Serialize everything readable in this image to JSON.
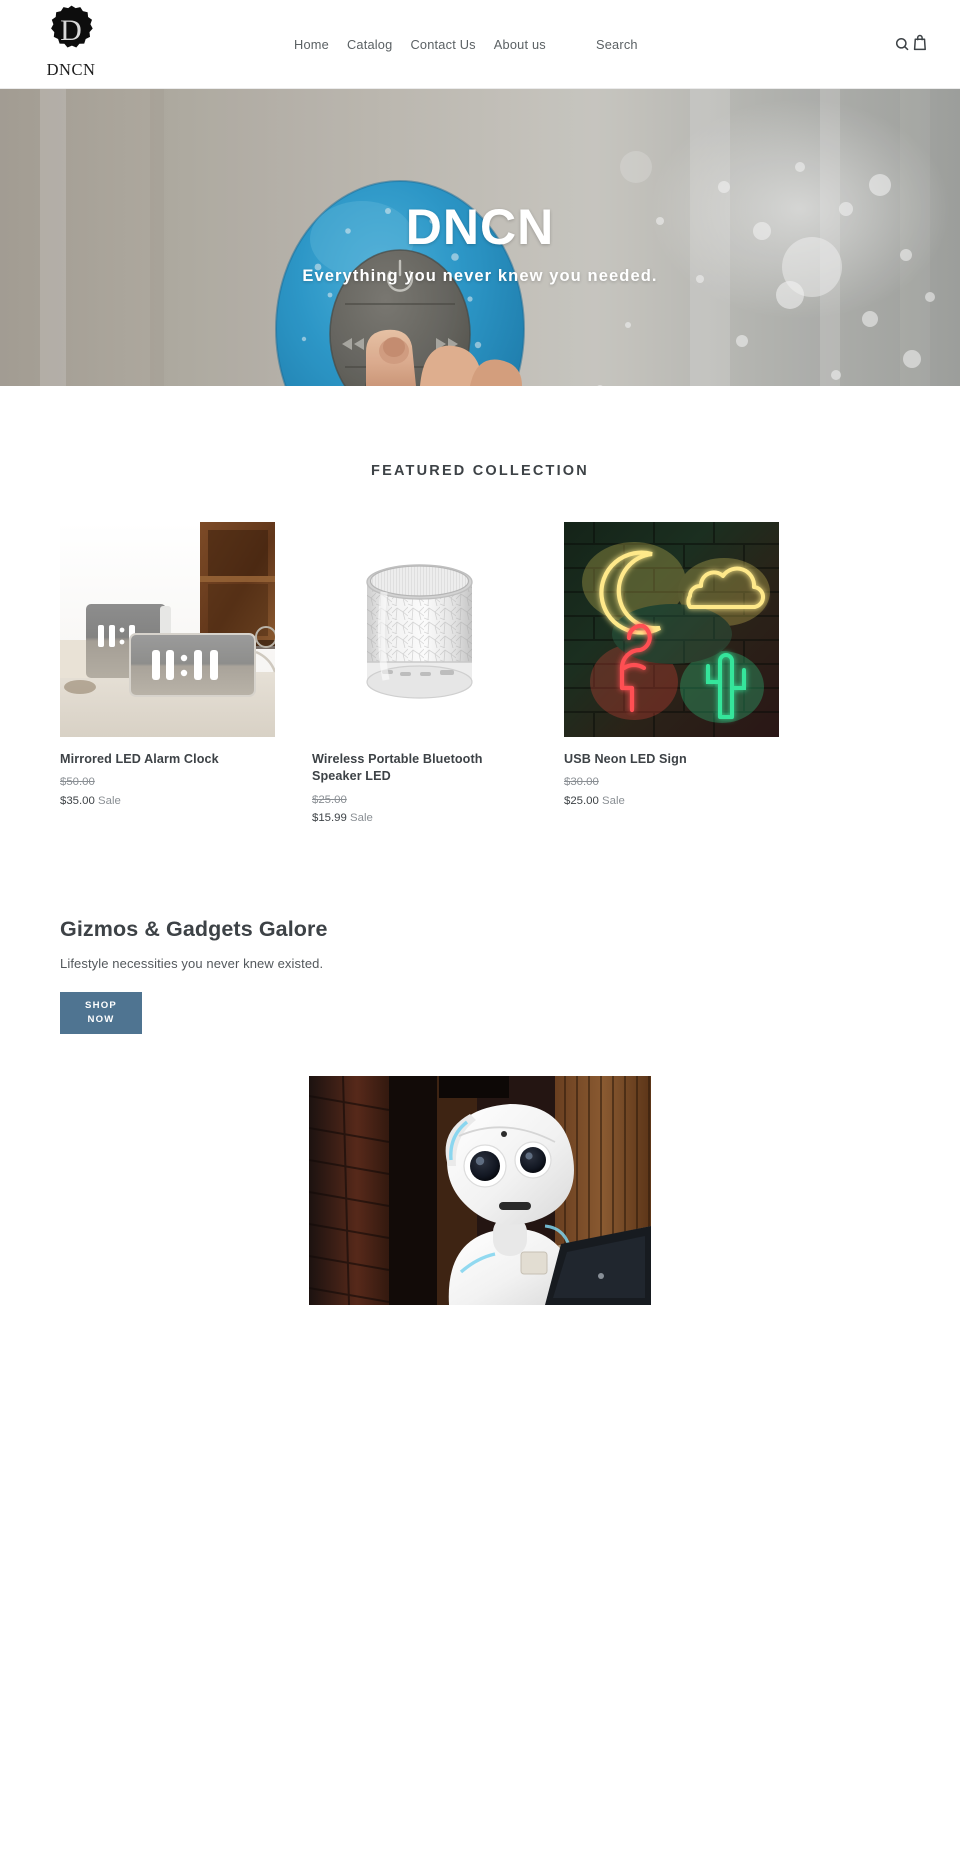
{
  "header": {
    "logo": {
      "letter": "D",
      "wordmark": "DNCN",
      "alt": "DNCN logo"
    },
    "nav": [
      {
        "label": "Home"
      },
      {
        "label": "Catalog"
      },
      {
        "label": "Contact Us"
      },
      {
        "label": "About us"
      }
    ],
    "search_label": "Search",
    "icons": {
      "search": "search-icon",
      "cart": "shopping-bag-icon"
    }
  },
  "hero": {
    "title": "DNCN",
    "subtitle": "Everything you never knew you needed.",
    "image_alt": "Blue waterproof shower bluetooth speaker being pressed by a finger on wet glass"
  },
  "featured": {
    "heading": "FEATURED COLLECTION",
    "products": [
      {
        "title": "Mirrored LED Alarm Clock",
        "price_old": "$50.00",
        "price_new": "$35.00",
        "sale_label": "Sale",
        "image_alt": "Two mirrored LED alarm clocks displaying 14:34 on a carpet by a wooden shelf"
      },
      {
        "title": "Wireless Portable Bluetooth Speaker LED",
        "price_old": "$25.00",
        "price_new": "$15.99",
        "sale_label": "Sale",
        "image_alt": "White cylindrical wireless bluetooth speaker with crackle texture"
      },
      {
        "title": "USB Neon LED Sign",
        "price_old": "$30.00",
        "price_new": "$25.00",
        "sale_label": "Sale",
        "image_alt": "Neon moon, cloud, flamingo and cactus signs on a dark brick wall"
      }
    ]
  },
  "promo": {
    "heading": "Gizmos & Gadgets Galore",
    "text": "Lifestyle necessities you never knew existed.",
    "button_line1": "SHOP",
    "button_line2": "NOW",
    "image_alt": "White humanoid Pepper robot holding a tablet in front of a brick and wood wall"
  },
  "colors": {
    "accent_button": "#4f7491",
    "text_primary": "#3d4246",
    "text_muted": "#8a8f94",
    "page_background": "#ffffff"
  }
}
